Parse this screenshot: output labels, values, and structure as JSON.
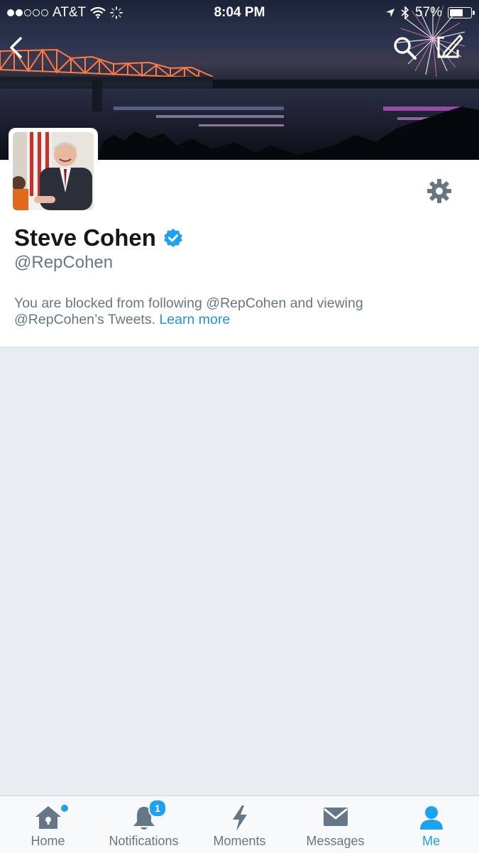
{
  "status_bar": {
    "carrier": "AT&T",
    "time": "8:04 PM",
    "battery_percent": "57%",
    "signal_bars": 2,
    "signal_total": 5
  },
  "header": {
    "back_icon": "chevron-left-icon",
    "search_icon": "search-icon",
    "compose_icon": "compose-icon"
  },
  "profile": {
    "name": "Steve Cohen",
    "handle": "@RepCohen",
    "verified": true,
    "settings_icon": "gear-icon"
  },
  "blocked_notice": {
    "text": "You are blocked from following @RepCohen and viewing @RepCohen’s Tweets.",
    "link": "Learn more"
  },
  "tabbar": {
    "tabs": [
      {
        "label": "Home",
        "icon": "home-icon"
      },
      {
        "label": "Notifications",
        "icon": "bell-icon",
        "badge": "1"
      },
      {
        "label": "Moments",
        "icon": "lightning-icon"
      },
      {
        "label": "Messages",
        "icon": "envelope-icon"
      },
      {
        "label": "Me",
        "icon": "person-icon"
      }
    ]
  },
  "colors": {
    "accent": "#1da1f2",
    "link": "#1b95e0",
    "muted_text": "#657786",
    "background": "#e6ecf0"
  }
}
